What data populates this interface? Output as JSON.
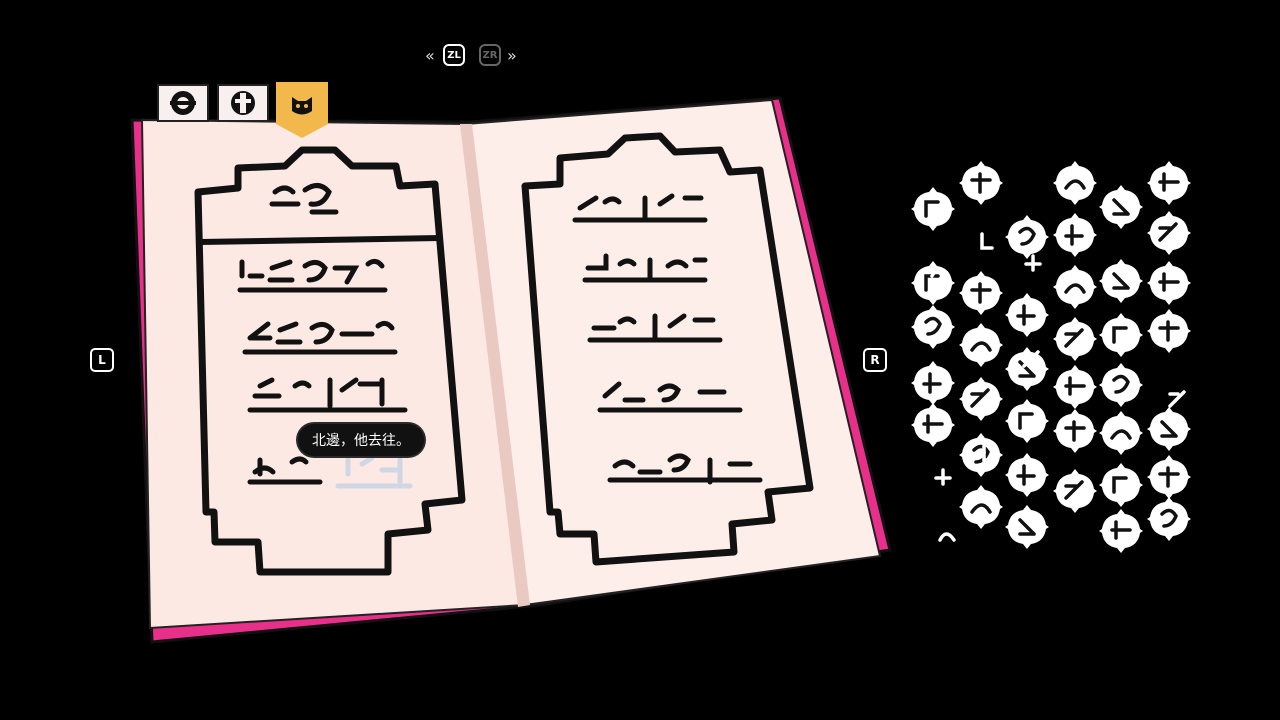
{
  "controls": {
    "prev_page_key": "ZL",
    "next_page_key": "ZR",
    "left_key": "L",
    "right_key": "R",
    "prev_chevron": "«",
    "next_chevron": "»"
  },
  "journal": {
    "tabs": [
      {
        "icon": "compass-emblem-icon",
        "active": false
      },
      {
        "icon": "cross-emblem-icon",
        "active": false
      },
      {
        "icon": "cat-mask-icon",
        "active": true
      }
    ],
    "tooltip": "北邊，他去往。",
    "colors": {
      "cover": "#e8308a",
      "page": "#fde9e4",
      "ink": "#111111",
      "tab_active": "#f2b84b"
    }
  }
}
